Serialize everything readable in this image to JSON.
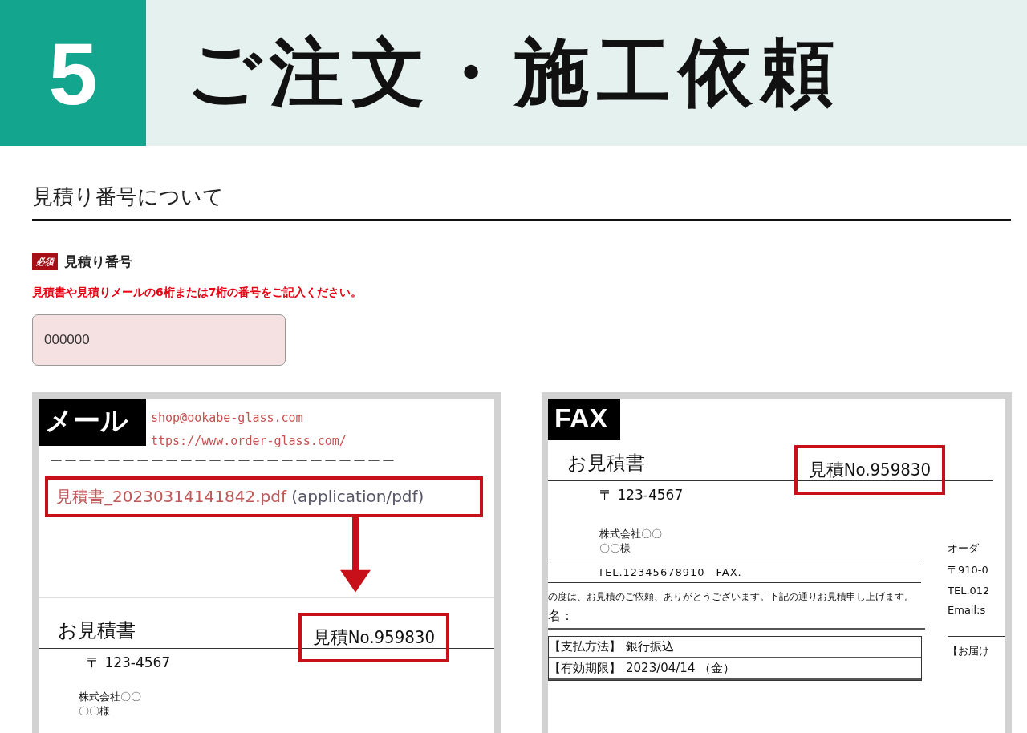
{
  "header": {
    "step": "5",
    "title": "ご注文・施工依頼"
  },
  "section": {
    "heading": "見積り番号について"
  },
  "field": {
    "required_badge": "必須",
    "label": "見積り番号",
    "note": "見積書や見積りメールの6桁または7桁の番号をご記入ください。",
    "value": "000000"
  },
  "examples": [
    {
      "kind": "mail",
      "tag": "メール",
      "email_lines": [
        "shop@ookabe-glass.com",
        "ttps://www.order-glass.com/"
      ],
      "separator": "ーーーーーーーーーーーーーーーーーーーーーーーー",
      "attachment": {
        "filename": "見積書_20230314141842.pdf",
        "mime": "(application/pdf)"
      },
      "doc_title": "お見積書",
      "estimate_no": "見積No.959830",
      "postal": "〒 123-4567",
      "company": "株式会社〇〇",
      "recipient": "〇〇様"
    },
    {
      "kind": "fax",
      "tag": "FAX",
      "doc_title": "お見積書",
      "estimate_no": "見積No.959830",
      "postal": "〒 123-4567",
      "company": "株式会社〇〇",
      "recipient": "〇〇様",
      "tel": "TEL.12345678910　FAX.",
      "greeting": "の度は、お見積のご依頼、ありがとうございます。下記の通りお見積申し上げます。",
      "subject": "名：",
      "rows": [
        {
          "label": "【支払方法】",
          "value": "銀行振込"
        },
        {
          "label": "【有効期限】",
          "value": "2023/04/14 （金）"
        }
      ],
      "sender": [
        "オーダ",
        "〒910-0",
        "TEL.012",
        "Email:s",
        "【お届け"
      ]
    }
  ]
}
